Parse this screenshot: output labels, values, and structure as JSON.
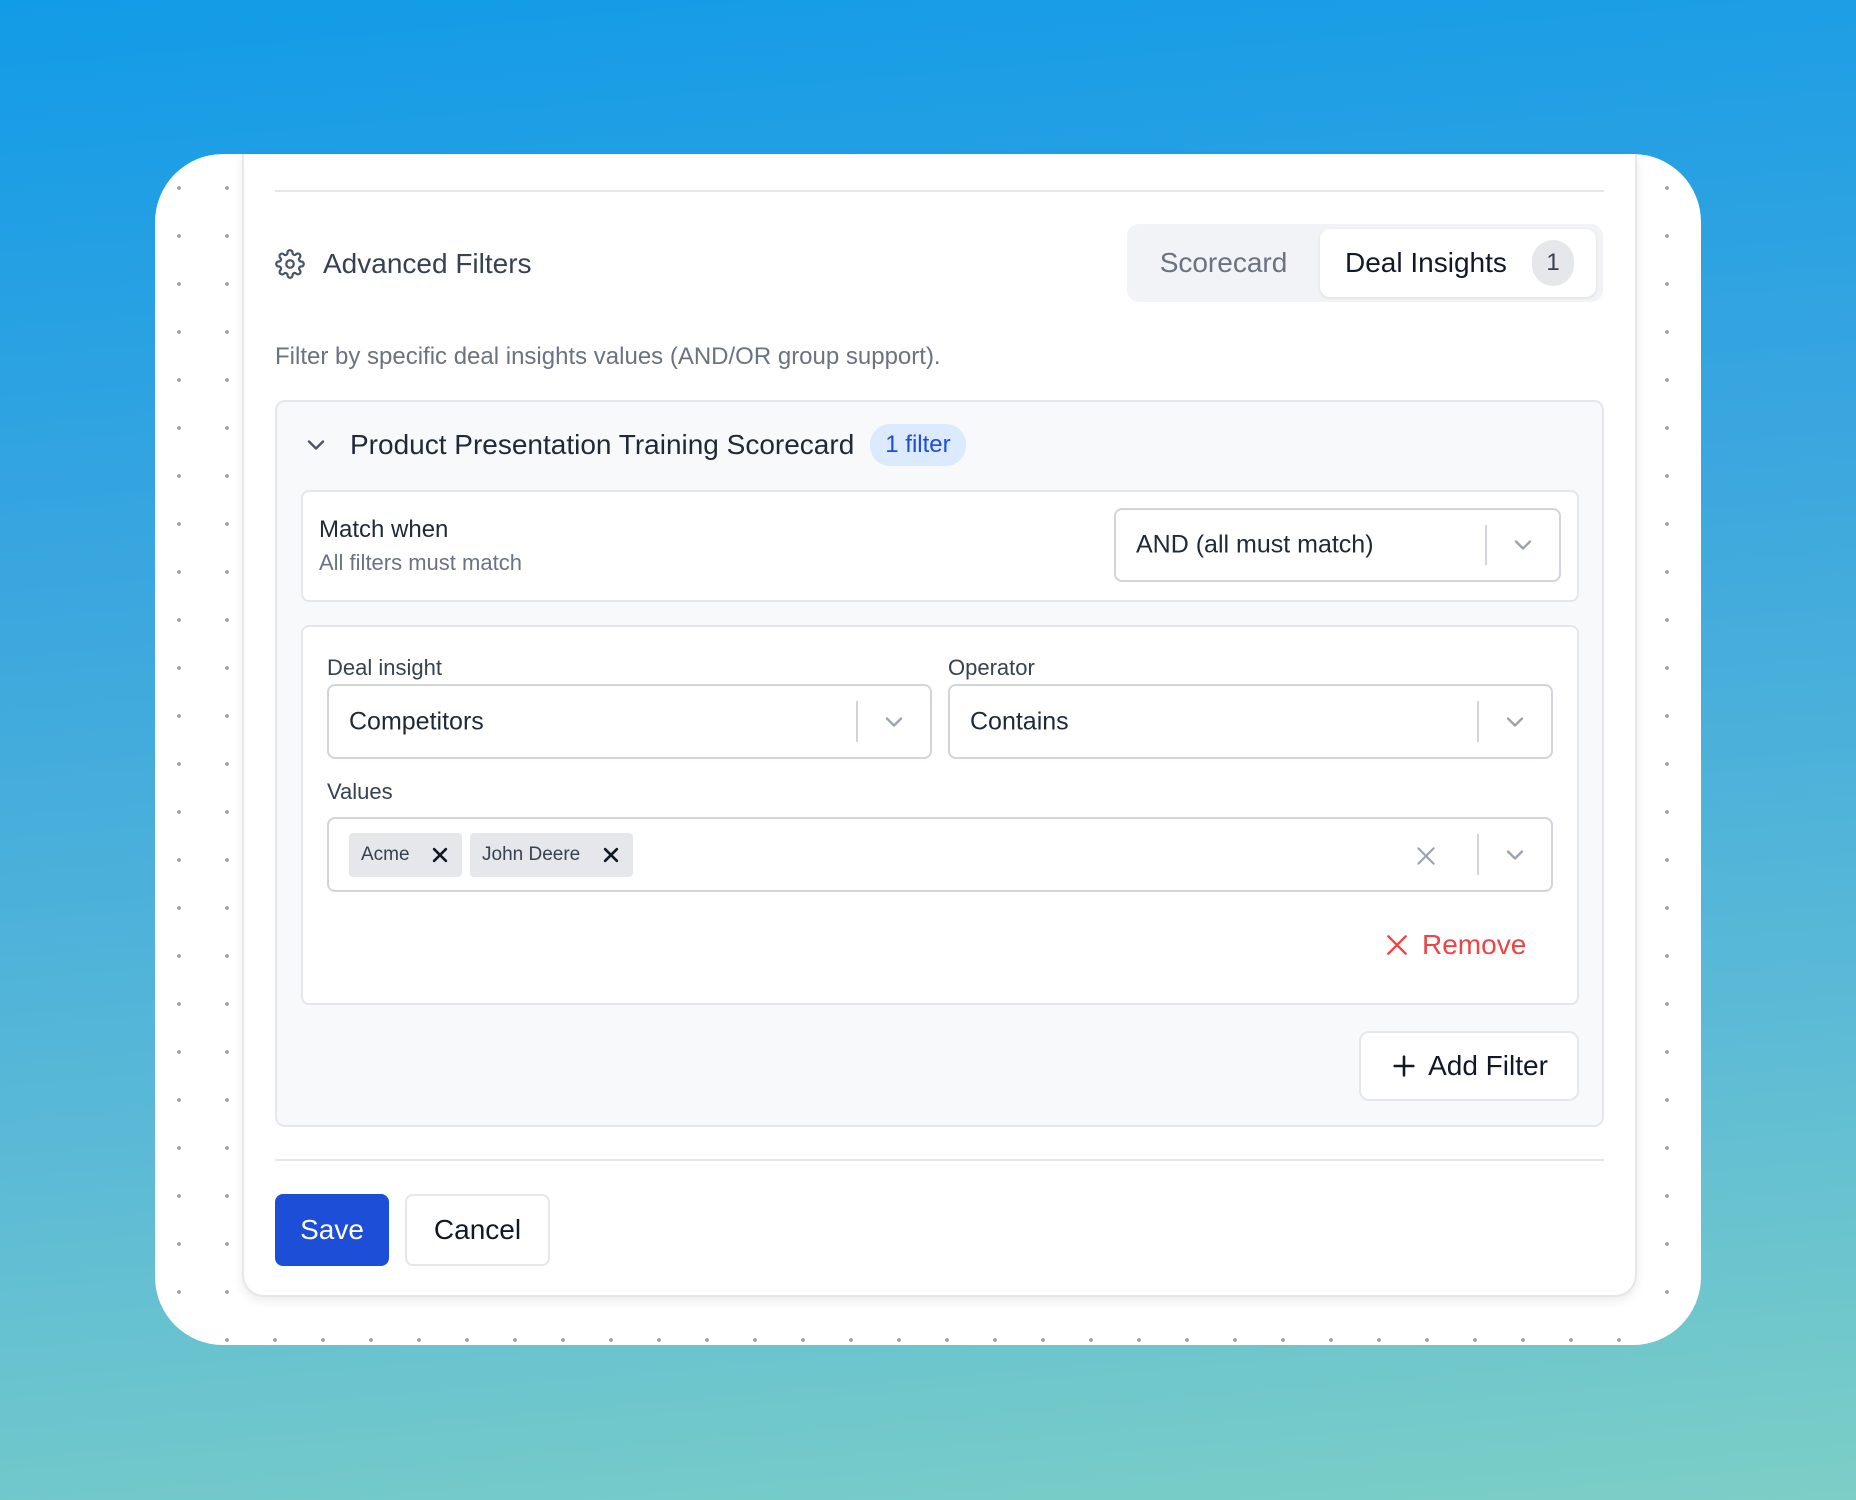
{
  "header": {
    "title": "Advanced Filters",
    "tabs": [
      {
        "label": "Scorecard"
      },
      {
        "label": "Deal Insights",
        "count": "1"
      }
    ],
    "description": "Filter by specific deal insights values (AND/OR group support)."
  },
  "group": {
    "title": "Product Presentation Training Scorecard",
    "badge": "1 filter",
    "match": {
      "label": "Match when",
      "sublabel": "All filters must match",
      "value": "AND (all must match)"
    },
    "filter": {
      "deal_insight_label": "Deal insight",
      "deal_insight_value": "Competitors",
      "operator_label": "Operator",
      "operator_value": "Contains",
      "values_label": "Values",
      "values": [
        "Acme",
        "John Deere"
      ],
      "remove_label": "Remove"
    },
    "add_filter_label": "Add Filter"
  },
  "footer": {
    "save_label": "Save",
    "cancel_label": "Cancel"
  },
  "colors": {
    "primary": "#1d4ed8",
    "danger": "#ef4444",
    "badge_bg": "#dbeafe"
  },
  "icons": [
    "gear-icon",
    "chevron-down-icon",
    "close-icon",
    "plus-icon"
  ]
}
